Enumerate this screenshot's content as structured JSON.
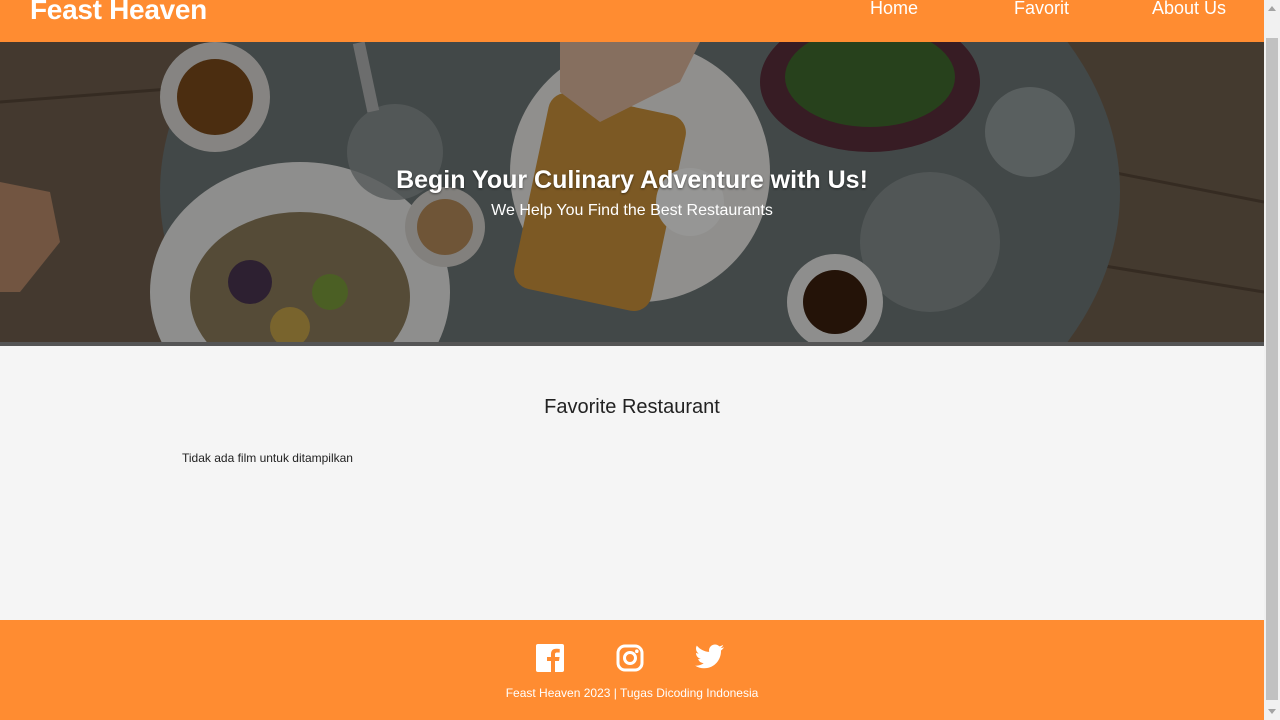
{
  "header": {
    "brand": "Feast Heaven",
    "nav": [
      {
        "label": "Home"
      },
      {
        "label": "Favorit"
      },
      {
        "label": "About Us"
      }
    ]
  },
  "hero": {
    "title": "Begin Your Culinary Adventure with Us!",
    "subtitle": "We Help You Find the Best Restaurants",
    "image": "hero-food-table-photo"
  },
  "main": {
    "title": "Favorite Restaurant",
    "empty_message": "Tidak ada film untuk ditampilkan"
  },
  "footer": {
    "social": [
      {
        "icon": "facebook-icon"
      },
      {
        "icon": "instagram-icon"
      },
      {
        "icon": "twitter-icon"
      }
    ],
    "copyright": "Feast Heaven 2023 | Tugas Dicoding Indonesia"
  },
  "colors": {
    "accent": "#ff8c31",
    "background": "#f5f5f5"
  }
}
